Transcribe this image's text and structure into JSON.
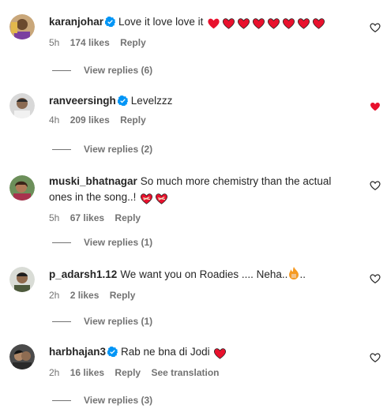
{
  "comments": [
    {
      "username": "karanjohar",
      "verified": true,
      "text": "Love it love love it",
      "hearts": 8,
      "time": "5h",
      "likes": "174 likes",
      "reply": "Reply",
      "view_replies": "View replies (6)",
      "liked": false
    },
    {
      "username": "ranveersingh",
      "verified": true,
      "text": "Levelzzz",
      "time": "4h",
      "likes": "209 likes",
      "reply": "Reply",
      "view_replies": "View replies (2)",
      "liked": true
    },
    {
      "username": "muski_bhatnagar",
      "verified": false,
      "text": "So much more chemistry than the actual ones in the song..!",
      "time": "5h",
      "likes": "67 likes",
      "reply": "Reply",
      "view_replies": "View replies (1)",
      "liked": false
    },
    {
      "username": "p_adarsh1.12",
      "verified": false,
      "text": "We want you on Roadies .... Neha..",
      "time": "2h",
      "likes": "2 likes",
      "reply": "Reply",
      "view_replies": "View replies (1)",
      "liked": false
    },
    {
      "username": "harbhajan3",
      "verified": true,
      "text": "Rab ne bna di Jodi",
      "time": "2h",
      "likes": "16 likes",
      "reply": "Reply",
      "see_translation": "See translation",
      "view_replies": "View replies (3)",
      "liked": false
    }
  ],
  "colors": {
    "heart_red": "#e8112d",
    "verified_blue": "#0095f6",
    "meta_gray": "#737373"
  }
}
